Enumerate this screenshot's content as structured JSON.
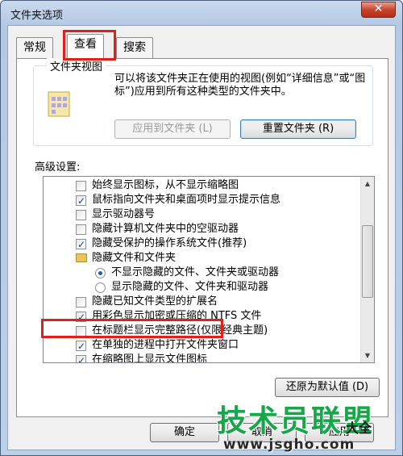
{
  "window": {
    "title": "文件夹选项",
    "close": "✕"
  },
  "tabs": [
    {
      "label": "常规",
      "active": false
    },
    {
      "label": "查看",
      "active": true
    },
    {
      "label": "搜索",
      "active": false
    }
  ],
  "folder_views": {
    "title": "文件夹视图",
    "description": "可以将该文件夹正在使用的视图(例如“详细信息”或“图标”)应用到所有这种类型的文件夹中。",
    "apply_button": "应用到文件夹 (L)",
    "reset_button": "重置文件夹 (R)"
  },
  "advanced": {
    "label": "高级设置:",
    "items": [
      {
        "type": "checkbox",
        "checked": false,
        "indent": 0,
        "label": "始终显示图标，从不显示缩略图"
      },
      {
        "type": "checkbox",
        "checked": true,
        "indent": 0,
        "label": "鼠标指向文件夹和桌面项时显示提示信息"
      },
      {
        "type": "checkbox",
        "checked": false,
        "indent": 0,
        "label": "显示驱动器号"
      },
      {
        "type": "checkbox",
        "checked": false,
        "indent": 0,
        "label": "隐藏计算机文件夹中的空驱动器"
      },
      {
        "type": "checkbox",
        "checked": true,
        "indent": 0,
        "label": "隐藏受保护的操作系统文件(推荐)"
      },
      {
        "type": "folder",
        "checked": false,
        "indent": 0,
        "label": "隐藏文件和文件夹"
      },
      {
        "type": "radio",
        "checked": true,
        "indent": 1,
        "label": "不显示隐藏的文件、文件夹或驱动器"
      },
      {
        "type": "radio",
        "checked": false,
        "indent": 1,
        "label": "显示隐藏的文件、文件夹和驱动器"
      },
      {
        "type": "checkbox",
        "checked": false,
        "indent": 0,
        "label": "隐藏已知文件类型的扩展名"
      },
      {
        "type": "checkbox",
        "checked": true,
        "indent": 0,
        "label": "用彩色显示加密或压缩的 NTFS 文件"
      },
      {
        "type": "checkbox",
        "checked": false,
        "indent": 0,
        "label": "在标题栏显示完整路径(仅限经典主题)"
      },
      {
        "type": "checkbox",
        "checked": true,
        "indent": 0,
        "label": "在单独的进程中打开文件夹窗口"
      },
      {
        "type": "checkbox",
        "checked": true,
        "indent": 0,
        "label": "在缩略图上显示文件图标"
      }
    ],
    "restore_button": "还原为默认值 (D)"
  },
  "footer": {
    "ok_button": "确定",
    "cancel_button": "取消",
    "apply_button": "应用"
  },
  "watermark": {
    "main": "技术员联盟",
    "sub": "大全",
    "url": "www.jsgho.com"
  }
}
